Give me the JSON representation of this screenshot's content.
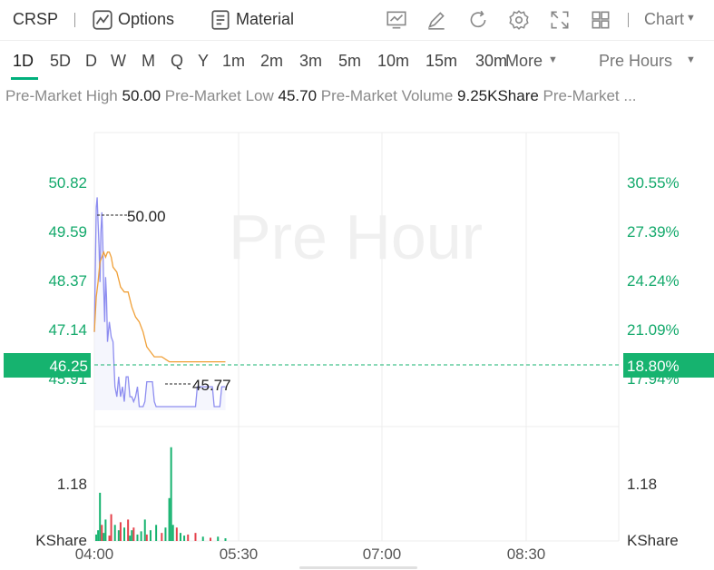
{
  "header": {
    "ticker": "CRSP",
    "options_label": "Options",
    "material_label": "Material",
    "chart_label": "Chart",
    "icons": [
      "indicator-icon",
      "draw-icon",
      "refresh-icon",
      "settings-icon",
      "fullscreen-icon",
      "layout-icon"
    ]
  },
  "ranges": {
    "items": [
      "1D",
      "5D",
      "D",
      "W",
      "M",
      "Q",
      "Y",
      "1m",
      "2m",
      "3m",
      "5m",
      "10m",
      "15m",
      "30m"
    ],
    "more_label": "More",
    "active": "1D",
    "session_label": "Pre Hours"
  },
  "stats": {
    "high_label": "Pre-Market High",
    "high_value": "50.00",
    "low_label": "Pre-Market Low",
    "low_value": "45.70",
    "volume_label": "Pre-Market Volume",
    "volume_value": "9.25KShare",
    "tail_label": "Pre-Market ..."
  },
  "chart_data": {
    "type": "line",
    "watermark": "Pre Hour",
    "x_ticks": [
      "04:00",
      "05:30",
      "07:00",
      "08:30"
    ],
    "y_left_ticks": [
      "50.82",
      "49.59",
      "48.37",
      "47.14",
      "45.91"
    ],
    "y_right_ticks": [
      "30.55%",
      "27.39%",
      "24.24%",
      "21.09%",
      "17.94%"
    ],
    "current_price": "46.25",
    "current_pct": "18.80%",
    "high_marker": "50.00",
    "low_marker": "45.77",
    "volume_tick": "1.18",
    "volume_unit": "KShare",
    "price_range": [
      45.4,
      51.3
    ],
    "time_range_min": [
      0,
      280
    ],
    "series": [
      {
        "values": [
          [
            0,
            47.3
          ],
          [
            0.5,
            48.5
          ],
          [
            1,
            49.8
          ],
          [
            1.5,
            50.0
          ],
          [
            2,
            49.5
          ],
          [
            2.5,
            49.0
          ],
          [
            3,
            48.3
          ],
          [
            3.5,
            49.3
          ],
          [
            4,
            49.7
          ],
          [
            4.5,
            49.1
          ],
          [
            5,
            48.2
          ],
          [
            5.5,
            47.5
          ],
          [
            6,
            48.4
          ],
          [
            6.5,
            48.0
          ],
          [
            7,
            47.1
          ],
          [
            8,
            47.5
          ],
          [
            9,
            47.2
          ],
          [
            10,
            47.1
          ],
          [
            11,
            46.2
          ],
          [
            12,
            46.0
          ],
          [
            13,
            46.4
          ],
          [
            14,
            46.0
          ],
          [
            15,
            46.2
          ],
          [
            16,
            45.9
          ],
          [
            17,
            46.4
          ],
          [
            18,
            46.4
          ],
          [
            19,
            46.0
          ],
          [
            20,
            46.0
          ],
          [
            21,
            45.9
          ],
          [
            22,
            46.0
          ],
          [
            23,
            46.2
          ],
          [
            24,
            45.8
          ],
          [
            25,
            45.8
          ],
          [
            26,
            45.8
          ],
          [
            27,
            45.9
          ],
          [
            28,
            46.3
          ],
          [
            29,
            46.3
          ],
          [
            30,
            46.3
          ],
          [
            31,
            46.3
          ],
          [
            32,
            45.9
          ],
          [
            33,
            45.8
          ],
          [
            34,
            45.8
          ],
          [
            36,
            45.8
          ],
          [
            38,
            45.8
          ],
          [
            40,
            45.8
          ],
          [
            44,
            45.8
          ],
          [
            48,
            45.8
          ],
          [
            52,
            45.8
          ],
          [
            54,
            45.8
          ],
          [
            55,
            46.2
          ],
          [
            56,
            46.2
          ],
          [
            58,
            46.2
          ],
          [
            60,
            46.2
          ],
          [
            63,
            46.2
          ],
          [
            64,
            45.8
          ],
          [
            66,
            45.8
          ],
          [
            67,
            45.8
          ],
          [
            68,
            46.2
          ],
          [
            70,
            46.2
          ]
        ]
      },
      {
        "values": [
          [
            0,
            47.3
          ],
          [
            1,
            48.0
          ],
          [
            2,
            48.3
          ],
          [
            3,
            48.7
          ],
          [
            4,
            48.8
          ],
          [
            5,
            48.9
          ],
          [
            6,
            48.8
          ],
          [
            7,
            48.9
          ],
          [
            8,
            48.9
          ],
          [
            9,
            48.8
          ],
          [
            10,
            48.6
          ],
          [
            12,
            48.5
          ],
          [
            14,
            48.2
          ],
          [
            16,
            48.1
          ],
          [
            18,
            48.1
          ],
          [
            20,
            47.8
          ],
          [
            22,
            47.6
          ],
          [
            24,
            47.5
          ],
          [
            26,
            47.3
          ],
          [
            28,
            47.0
          ],
          [
            30,
            46.9
          ],
          [
            32,
            46.8
          ],
          [
            34,
            46.8
          ],
          [
            36,
            46.8
          ],
          [
            40,
            46.7
          ],
          [
            44,
            46.7
          ],
          [
            50,
            46.7
          ],
          [
            56,
            46.7
          ],
          [
            62,
            46.7
          ],
          [
            70,
            46.7
          ]
        ]
      }
    ],
    "volume": [
      [
        1,
        0.12,
        "g"
      ],
      [
        2,
        0.2,
        "g"
      ],
      [
        3,
        0.9,
        "g"
      ],
      [
        4,
        0.3,
        "r"
      ],
      [
        5,
        0.15,
        "g"
      ],
      [
        6,
        0.4,
        "g"
      ],
      [
        8,
        0.1,
        "r"
      ],
      [
        9,
        0.5,
        "r"
      ],
      [
        11,
        0.3,
        "g"
      ],
      [
        13,
        0.2,
        "g"
      ],
      [
        14,
        0.35,
        "r"
      ],
      [
        16,
        0.25,
        "g"
      ],
      [
        18,
        0.4,
        "r"
      ],
      [
        19,
        0.1,
        "g"
      ],
      [
        20,
        0.2,
        "g"
      ],
      [
        21,
        0.25,
        "r"
      ],
      [
        23,
        0.12,
        "g"
      ],
      [
        25,
        0.18,
        "g"
      ],
      [
        27,
        0.4,
        "g"
      ],
      [
        28,
        0.12,
        "r"
      ],
      [
        30,
        0.2,
        "g"
      ],
      [
        33,
        0.3,
        "g"
      ],
      [
        36,
        0.15,
        "r"
      ],
      [
        38,
        0.25,
        "g"
      ],
      [
        40,
        0.8,
        "g"
      ],
      [
        41,
        1.75,
        "g"
      ],
      [
        42,
        0.3,
        "g"
      ],
      [
        44,
        0.25,
        "r"
      ],
      [
        46,
        0.15,
        "g"
      ],
      [
        48,
        0.1,
        "g"
      ],
      [
        50,
        0.12,
        "r"
      ],
      [
        54,
        0.15,
        "r"
      ],
      [
        58,
        0.08,
        "g"
      ],
      [
        62,
        0.06,
        "r"
      ],
      [
        66,
        0.08,
        "g"
      ],
      [
        70,
        0.05,
        "g"
      ]
    ],
    "volume_max": 2.0,
    "colors": {
      "up": "#16b36f",
      "down": "#e5414b",
      "price_line": "#8d8df0",
      "avg_line": "#f0a038",
      "axis_text": "#13a96b",
      "current_bg": "#16b36f"
    }
  }
}
